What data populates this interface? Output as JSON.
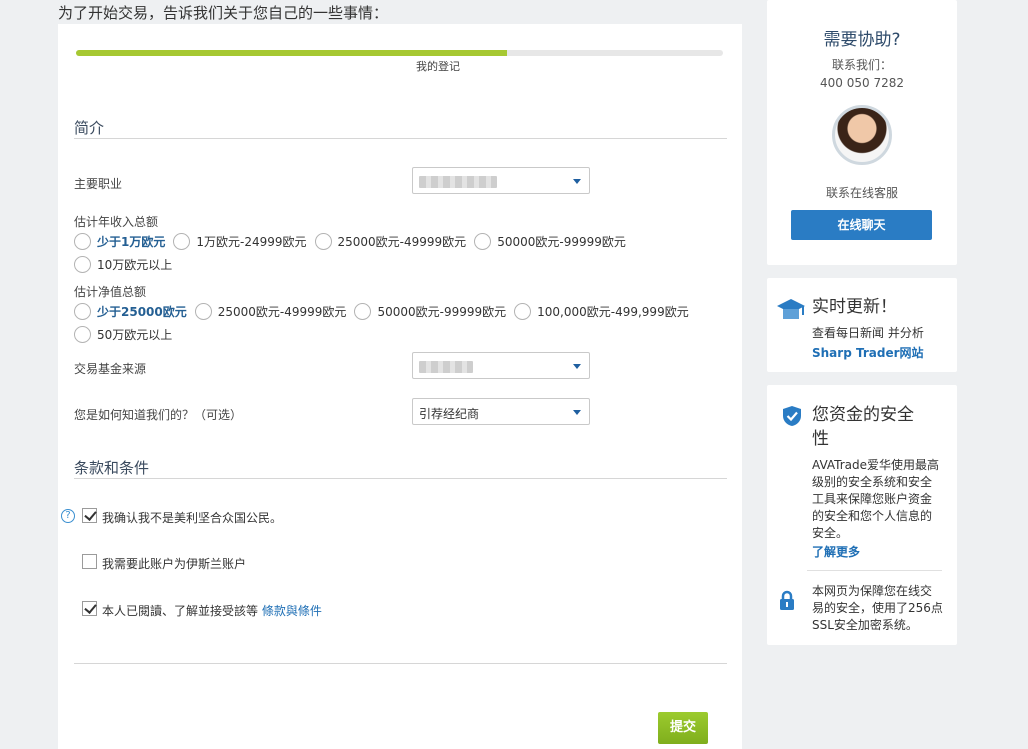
{
  "page": {
    "heading": "为了开始交易，告诉我们关于您自己的一些事情：",
    "progress": {
      "label": "我的登记",
      "fraction": 0.67
    }
  },
  "profile": {
    "section_title": "简介",
    "occupation": {
      "label": "主要职业"
    },
    "annual_income": {
      "label": "估计年收入总额",
      "options": [
        "少于1万欧元",
        "1万欧元-24999欧元",
        "25000欧元-49999欧元",
        "50000欧元-99999欧元",
        "10万欧元以上"
      ]
    },
    "net_worth": {
      "label": "估计净值总额",
      "options": [
        "少于25000欧元",
        "25000欧元-49999欧元",
        "50000欧元-99999欧元",
        "100,000欧元-499,999欧元",
        "50万欧元以上"
      ]
    },
    "fund_source": {
      "label": "交易基金来源"
    },
    "referral": {
      "label": "您是如何知道我们的？（可选）",
      "value": "引荐经纪商"
    }
  },
  "terms": {
    "section_title": "条款和条件",
    "help_glyph": "?",
    "us_citizen": {
      "label": "我确认我不是美利坚合众国公民。",
      "checked": true
    },
    "islamic": {
      "label": "我需要此账户为伊斯兰账户",
      "checked": false
    },
    "agree": {
      "label": "本人已閱讀、了解並接受該等",
      "link": "條款與條件",
      "checked": true
    }
  },
  "submit_label": "提交",
  "sidebar": {
    "help": {
      "title": "需要协助?",
      "contact_label": "联系我们：",
      "phone": "400 050 7282",
      "online_label": "联系在线客服",
      "chat_button": "在线聊天"
    },
    "news": {
      "title": "实时更新！",
      "body": "查看每日新闻 并分析",
      "link": "Sharp Trader网站"
    },
    "security": {
      "title_line1": "您资金的安全",
      "title_line2": "性",
      "body_lines": [
        "AVATrade爱华使用最高",
        "级别的安全系统和安全",
        "工具来保障您账户资金",
        "的安全和您个人信息的",
        "安全。"
      ],
      "learn_more": "了解更多",
      "ssl_lines": [
        "本网页为保障您在线交",
        "易的安全，使用了256点",
        "SSL安全加密系统。"
      ]
    }
  },
  "icons": [
    "question-circle-icon",
    "caret-down-icon",
    "graduation-cap-icon",
    "shield-check-icon",
    "lock-icon",
    "checkmark-icon"
  ],
  "colors": {
    "progress": "#a6c832",
    "link": "#1f6fb5",
    "submit": "#8dbd25",
    "chat": "#2a7cc4"
  }
}
